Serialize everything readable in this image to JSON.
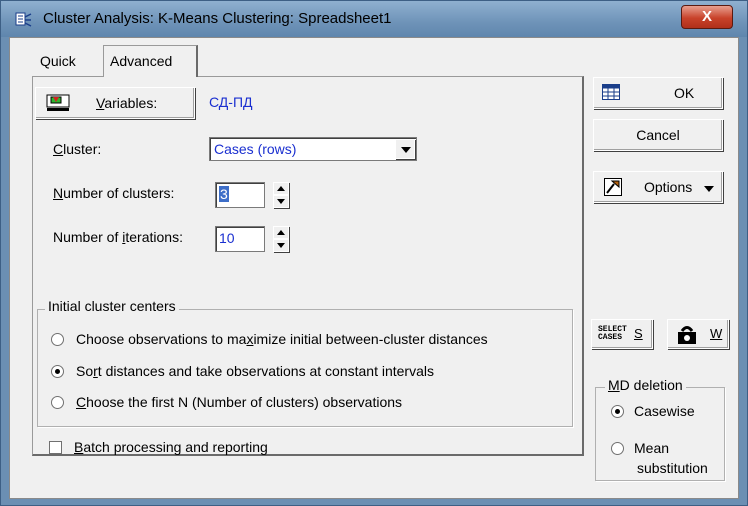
{
  "window": {
    "title": "Cluster Analysis: K-Means Clustering: Spreadsheet1",
    "close_label": "X"
  },
  "tabs": [
    {
      "label": "Quick"
    },
    {
      "label": "Advanced"
    }
  ],
  "variables": {
    "button_label_prefix": "",
    "button_label_mnemonic": "V",
    "button_label_rest": "ariables:",
    "value": "СД-ПД"
  },
  "cluster": {
    "label": "Cluster:",
    "selected": "Cases (rows)"
  },
  "num_clusters": {
    "label_mnemonic": "N",
    "label_rest": "umber of clusters:",
    "value": "3"
  },
  "num_iterations": {
    "label_pre": "Number of ",
    "label_mnemonic": "i",
    "label_rest": "terations:",
    "value": "10"
  },
  "initial_centers": {
    "title": "Initial cluster centers",
    "options": [
      {
        "pre": "Choose observations to ma",
        "mn": "x",
        "post": "imize initial between-cluster distances",
        "selected": false
      },
      {
        "pre": "So",
        "mn": "r",
        "post": "t distances and take observations at constant intervals",
        "selected": true
      },
      {
        "pre": "",
        "mn": "C",
        "post": "hoose the first N (Number of clusters) observations",
        "selected": false
      }
    ]
  },
  "batch": {
    "mnemonic": "B",
    "rest": "atch processing and reporting",
    "checked": false
  },
  "side": {
    "ok": "OK",
    "cancel": "Cancel",
    "options": "Options",
    "select_cases_line1": "SELECT",
    "select_cases_line2": "CASES",
    "select_cases_key": "S",
    "weight_key": "W"
  },
  "md_deletion": {
    "title_mnemonic": "M",
    "title_rest": "D deletion",
    "options": [
      {
        "label": "Casewise",
        "selected": true
      },
      {
        "label": "Mean",
        "label2": "substitution",
        "selected": false
      }
    ]
  }
}
